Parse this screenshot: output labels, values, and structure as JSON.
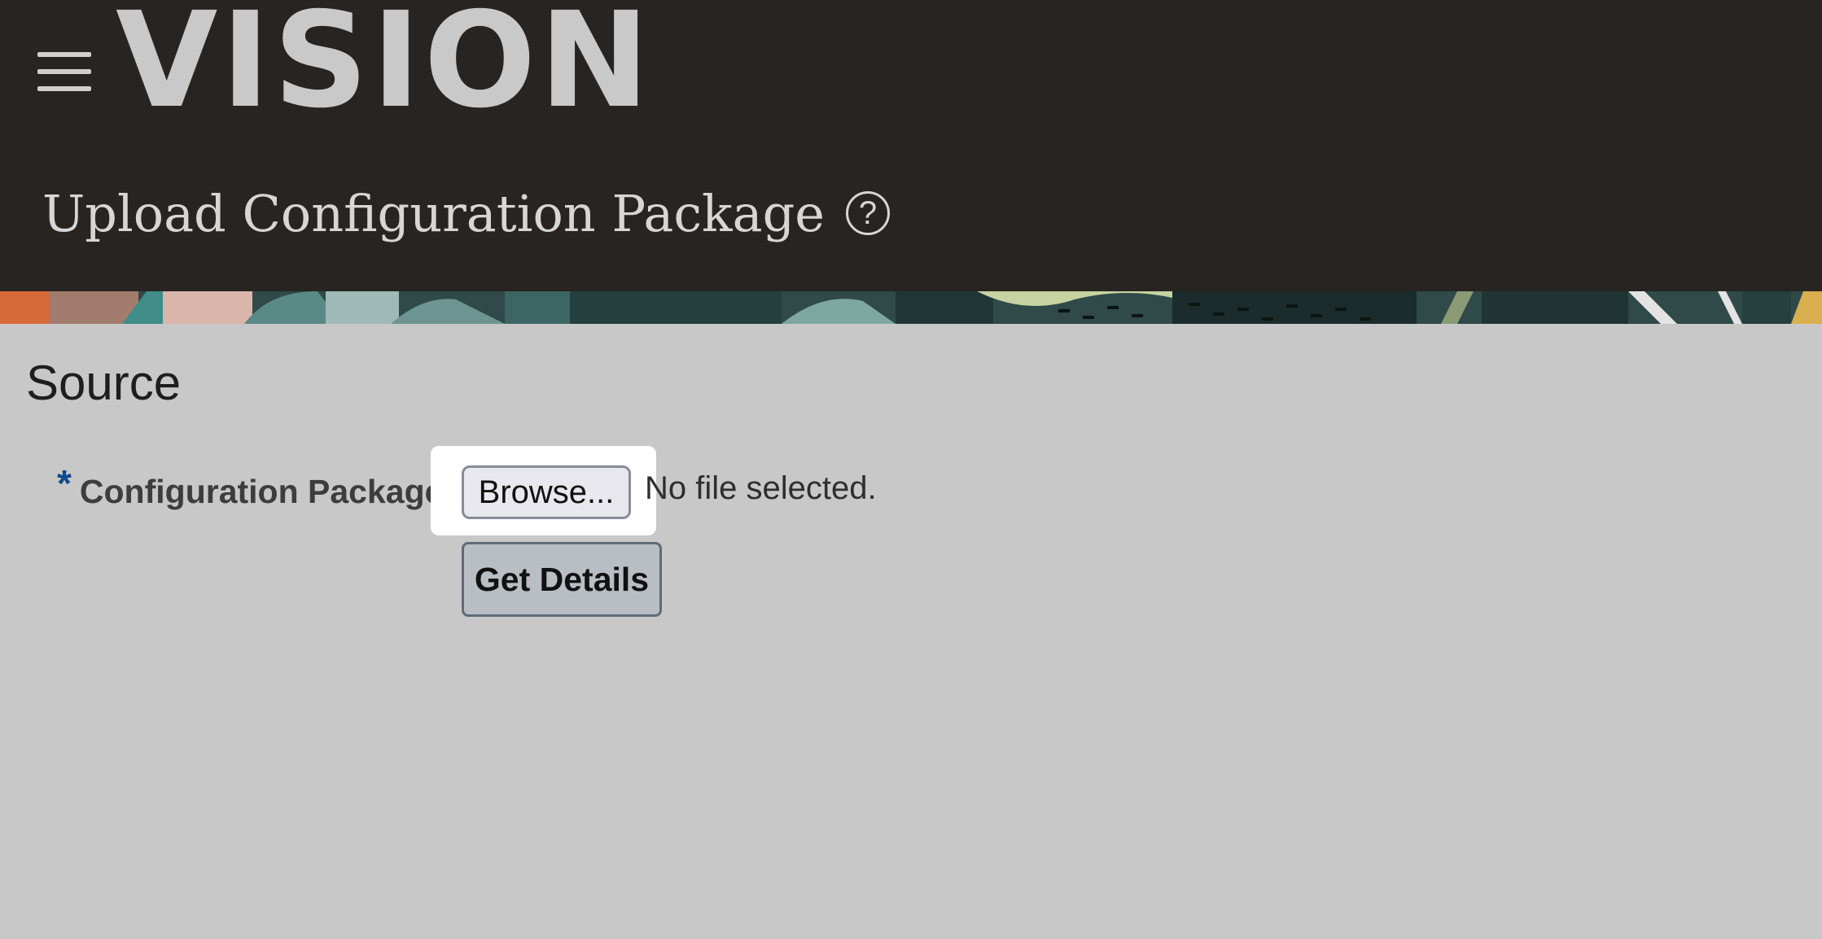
{
  "header": {
    "logo_text": "VISION",
    "menu_icon": "hamburger-menu-icon",
    "page_title": "Upload Configuration Package",
    "help_icon": "help-question-icon",
    "help_glyph": "?"
  },
  "banner": {
    "description": "decorative-pattern",
    "colors": [
      "#d86a3a",
      "#3f8c8a",
      "#d9b5ac",
      "#9fb9b6",
      "#1f3634",
      "#c7d3a0",
      "#d9b04d"
    ]
  },
  "source": {
    "section_title": "Source",
    "required_marker": "*",
    "field_label": "Configuration Package",
    "browse_label": "Browse...",
    "file_status": "No file selected.",
    "get_details_label": "Get Details"
  },
  "colors": {
    "header_bg": "#282421",
    "page_bg": "#c8c8c8",
    "required": "#0d4a8f"
  }
}
